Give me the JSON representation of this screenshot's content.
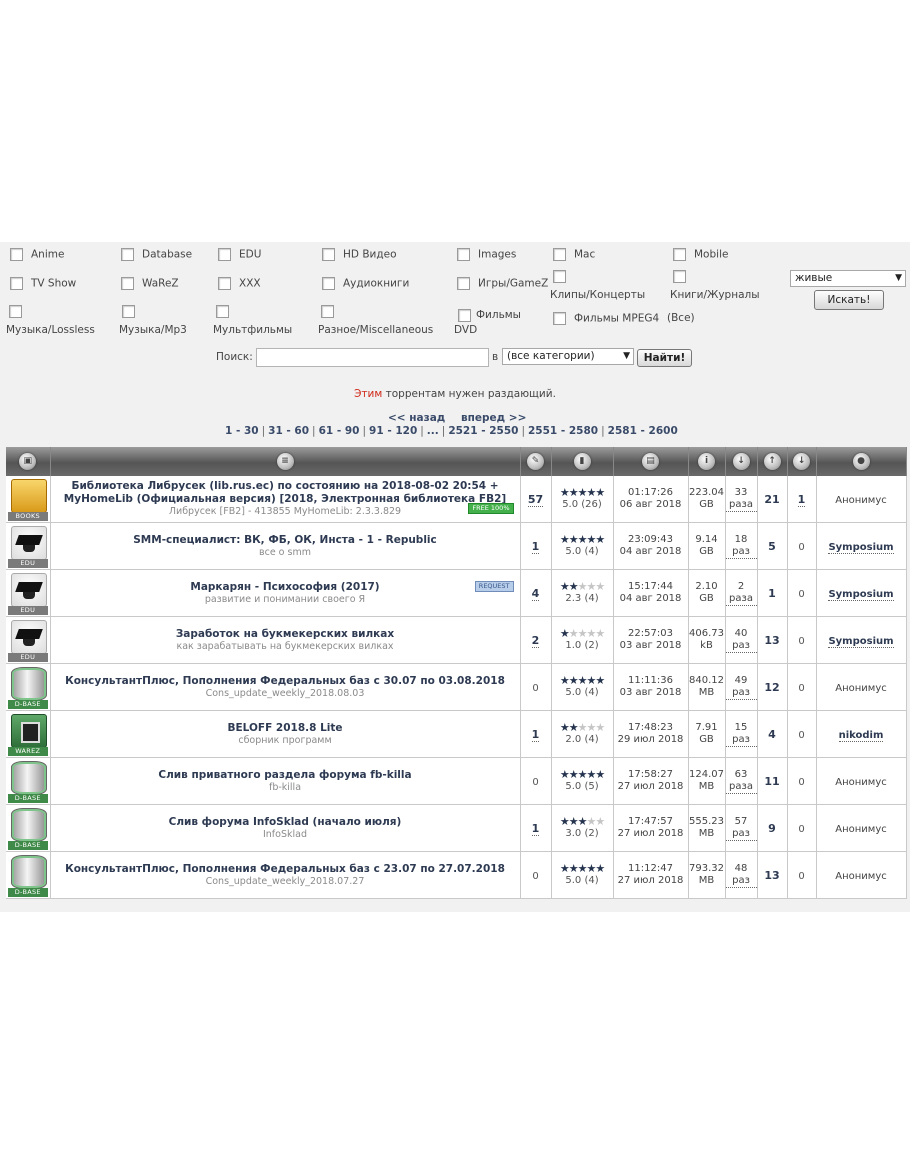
{
  "categories": [
    {
      "id": "anime",
      "label": "Anime"
    },
    {
      "id": "database",
      "label": "Database"
    },
    {
      "id": "edu",
      "label": "EDU"
    },
    {
      "id": "hd",
      "label": "HD Видео"
    },
    {
      "id": "images",
      "label": "Images"
    },
    {
      "id": "mac",
      "label": "Mac"
    },
    {
      "id": "mobile",
      "label": "Mobile"
    },
    {
      "id": "tvshow",
      "label": "TV Show"
    },
    {
      "id": "warez",
      "label": "WaReZ"
    },
    {
      "id": "xxx",
      "label": "XXX"
    },
    {
      "id": "audiobooks",
      "label": "Аудиокниги"
    },
    {
      "id": "games",
      "label": "Игры/GameZ"
    },
    {
      "id": "clips",
      "label": "Клипы/Концерты"
    },
    {
      "id": "books",
      "label": "Книги/Журналы"
    },
    {
      "id": "lossless",
      "label": "Музыка/Lossless"
    },
    {
      "id": "mp3",
      "label": "Музыка/Mp3"
    },
    {
      "id": "cartoons",
      "label": "Мультфильмы"
    },
    {
      "id": "misc",
      "label": "Разное/Miscellaneous"
    },
    {
      "id": "dvd",
      "label": "Фильмы DVD"
    },
    {
      "id": "mpeg4",
      "label": "Фильмы MPEG4"
    }
  ],
  "all_link": "(Все)",
  "status_select": "живые",
  "search_button": "Искать!",
  "search": {
    "label": "Поиск:",
    "value": "",
    "in_label": "в",
    "category_select": "(все категории)",
    "find_button": "Найти!"
  },
  "notice": {
    "link": "Этим",
    "text": " торрентам нужен раздающий."
  },
  "nav": {
    "prev": "<< назад",
    "next": "вперед >>"
  },
  "pages": [
    "1 - 30",
    "31 - 60",
    "61 - 90",
    "91 - 120",
    "...",
    "2521 - 2550",
    "2551 - 2580",
    "2581 - 2600"
  ],
  "rows": [
    {
      "cat": "books",
      "tag": "BOOKS",
      "title": "Библиотека Либрусек (lib.rus.ec) по состоянию на 2018-08-02 20:54 + MyHomeLib (Официальная версия) [2018, Электронная библиотека FB2]",
      "desc": "Либрусек [FB2] - 413855 MyHomeLib: 2.3.3.829",
      "badge": "FREE 100%",
      "badge_type": "free",
      "comments": "57",
      "stars": 5,
      "rating": "5.0 (26)",
      "time": "01:17:26",
      "date": "06 авг 2018",
      "size": "223.04",
      "unit": "GB",
      "dl": "33",
      "dl_unit": "раза",
      "seeds": "21",
      "leech": "1",
      "user": "Анонимус",
      "user_bold": false
    },
    {
      "cat": "edu",
      "tag": "EDU",
      "title": "SMM-специалист: ВК, ФБ, ОК, Инста - 1 - Republic",
      "desc": "все о smm",
      "badge": "",
      "badge_type": "",
      "comments": "1",
      "stars": 5,
      "rating": "5.0 (4)",
      "time": "23:09:43",
      "date": "04 авг 2018",
      "size": "9.14",
      "unit": "GB",
      "dl": "18",
      "dl_unit": "раз",
      "seeds": "5",
      "leech": "0",
      "user": "Symposium",
      "user_bold": true
    },
    {
      "cat": "edu",
      "tag": "EDU",
      "title": "Маркарян - Психософия (2017)",
      "desc": "развитие и понимании своего Я",
      "badge": "REQUEST",
      "badge_type": "req",
      "comments": "4",
      "stars": 2,
      "rating": "2.3 (4)",
      "time": "15:17:44",
      "date": "04 авг 2018",
      "size": "2.10",
      "unit": "GB",
      "dl": "2",
      "dl_unit": "раза",
      "seeds": "1",
      "leech": "0",
      "user": "Symposium",
      "user_bold": true
    },
    {
      "cat": "edu",
      "tag": "EDU",
      "title": "Заработок на букмекерских вилках",
      "desc": "как зарабатывать на букмекерских вилках",
      "badge": "",
      "badge_type": "",
      "comments": "2",
      "stars": 1,
      "rating": "1.0 (2)",
      "time": "22:57:03",
      "date": "03 авг 2018",
      "size": "406.73",
      "unit": "kB",
      "dl": "40",
      "dl_unit": "раз",
      "seeds": "13",
      "leech": "0",
      "user": "Symposium",
      "user_bold": true
    },
    {
      "cat": "dbase",
      "tag": "D-BASE",
      "title": "КонсультантПлюс, Пополнения Федеральных баз с 30.07 по 03.08.2018",
      "desc": "Cons_update_weekly_2018.08.03",
      "badge": "",
      "badge_type": "",
      "comments": "0",
      "stars": 5,
      "rating": "5.0 (4)",
      "time": "11:11:36",
      "date": "03 авг 2018",
      "size": "840.12",
      "unit": "MB",
      "dl": "49",
      "dl_unit": "раз",
      "seeds": "12",
      "leech": "0",
      "user": "Анонимус",
      "user_bold": false
    },
    {
      "cat": "warez",
      "tag": "WAREZ",
      "title": "BELOFF 2018.8 Lite",
      "desc": "сборник программ",
      "badge": "",
      "badge_type": "",
      "comments": "1",
      "stars": 2,
      "rating": "2.0 (4)",
      "time": "17:48:23",
      "date": "29 июл 2018",
      "size": "7.91",
      "unit": "GB",
      "dl": "15",
      "dl_unit": "раз",
      "seeds": "4",
      "leech": "0",
      "user": "nikodim",
      "user_bold": true
    },
    {
      "cat": "dbase",
      "tag": "D-BASE",
      "title": "Слив приватного раздела форума fb-killa",
      "desc": "fb-killa",
      "badge": "",
      "badge_type": "",
      "comments": "0",
      "stars": 5,
      "rating": "5.0 (5)",
      "time": "17:58:27",
      "date": "27 июл 2018",
      "size": "124.07",
      "unit": "MB",
      "dl": "63",
      "dl_unit": "раза",
      "seeds": "11",
      "leech": "0",
      "user": "Анонимус",
      "user_bold": false
    },
    {
      "cat": "dbase",
      "tag": "D-BASE",
      "title": "Слив форума InfoSklad (начало июля)",
      "desc": "InfoSklad",
      "badge": "",
      "badge_type": "",
      "comments": "1",
      "stars": 3,
      "rating": "3.0 (2)",
      "time": "17:47:57",
      "date": "27 июл 2018",
      "size": "555.23",
      "unit": "MB",
      "dl": "57",
      "dl_unit": "раз",
      "seeds": "9",
      "leech": "0",
      "user": "Анонимус",
      "user_bold": false
    },
    {
      "cat": "dbase",
      "tag": "D-BASE",
      "title": "КонсультантПлюс, Пополнения Федеральных баз с 23.07 по 27.07.2018",
      "desc": "Cons_update_weekly_2018.07.27",
      "badge": "",
      "badge_type": "",
      "comments": "0",
      "stars": 5,
      "rating": "5.0 (4)",
      "time": "11:12:47",
      "date": "27 июл 2018",
      "size": "793.32",
      "unit": "MB",
      "dl": "48",
      "dl_unit": "раз",
      "seeds": "13",
      "leech": "0",
      "user": "Анонимус",
      "user_bold": false
    }
  ]
}
